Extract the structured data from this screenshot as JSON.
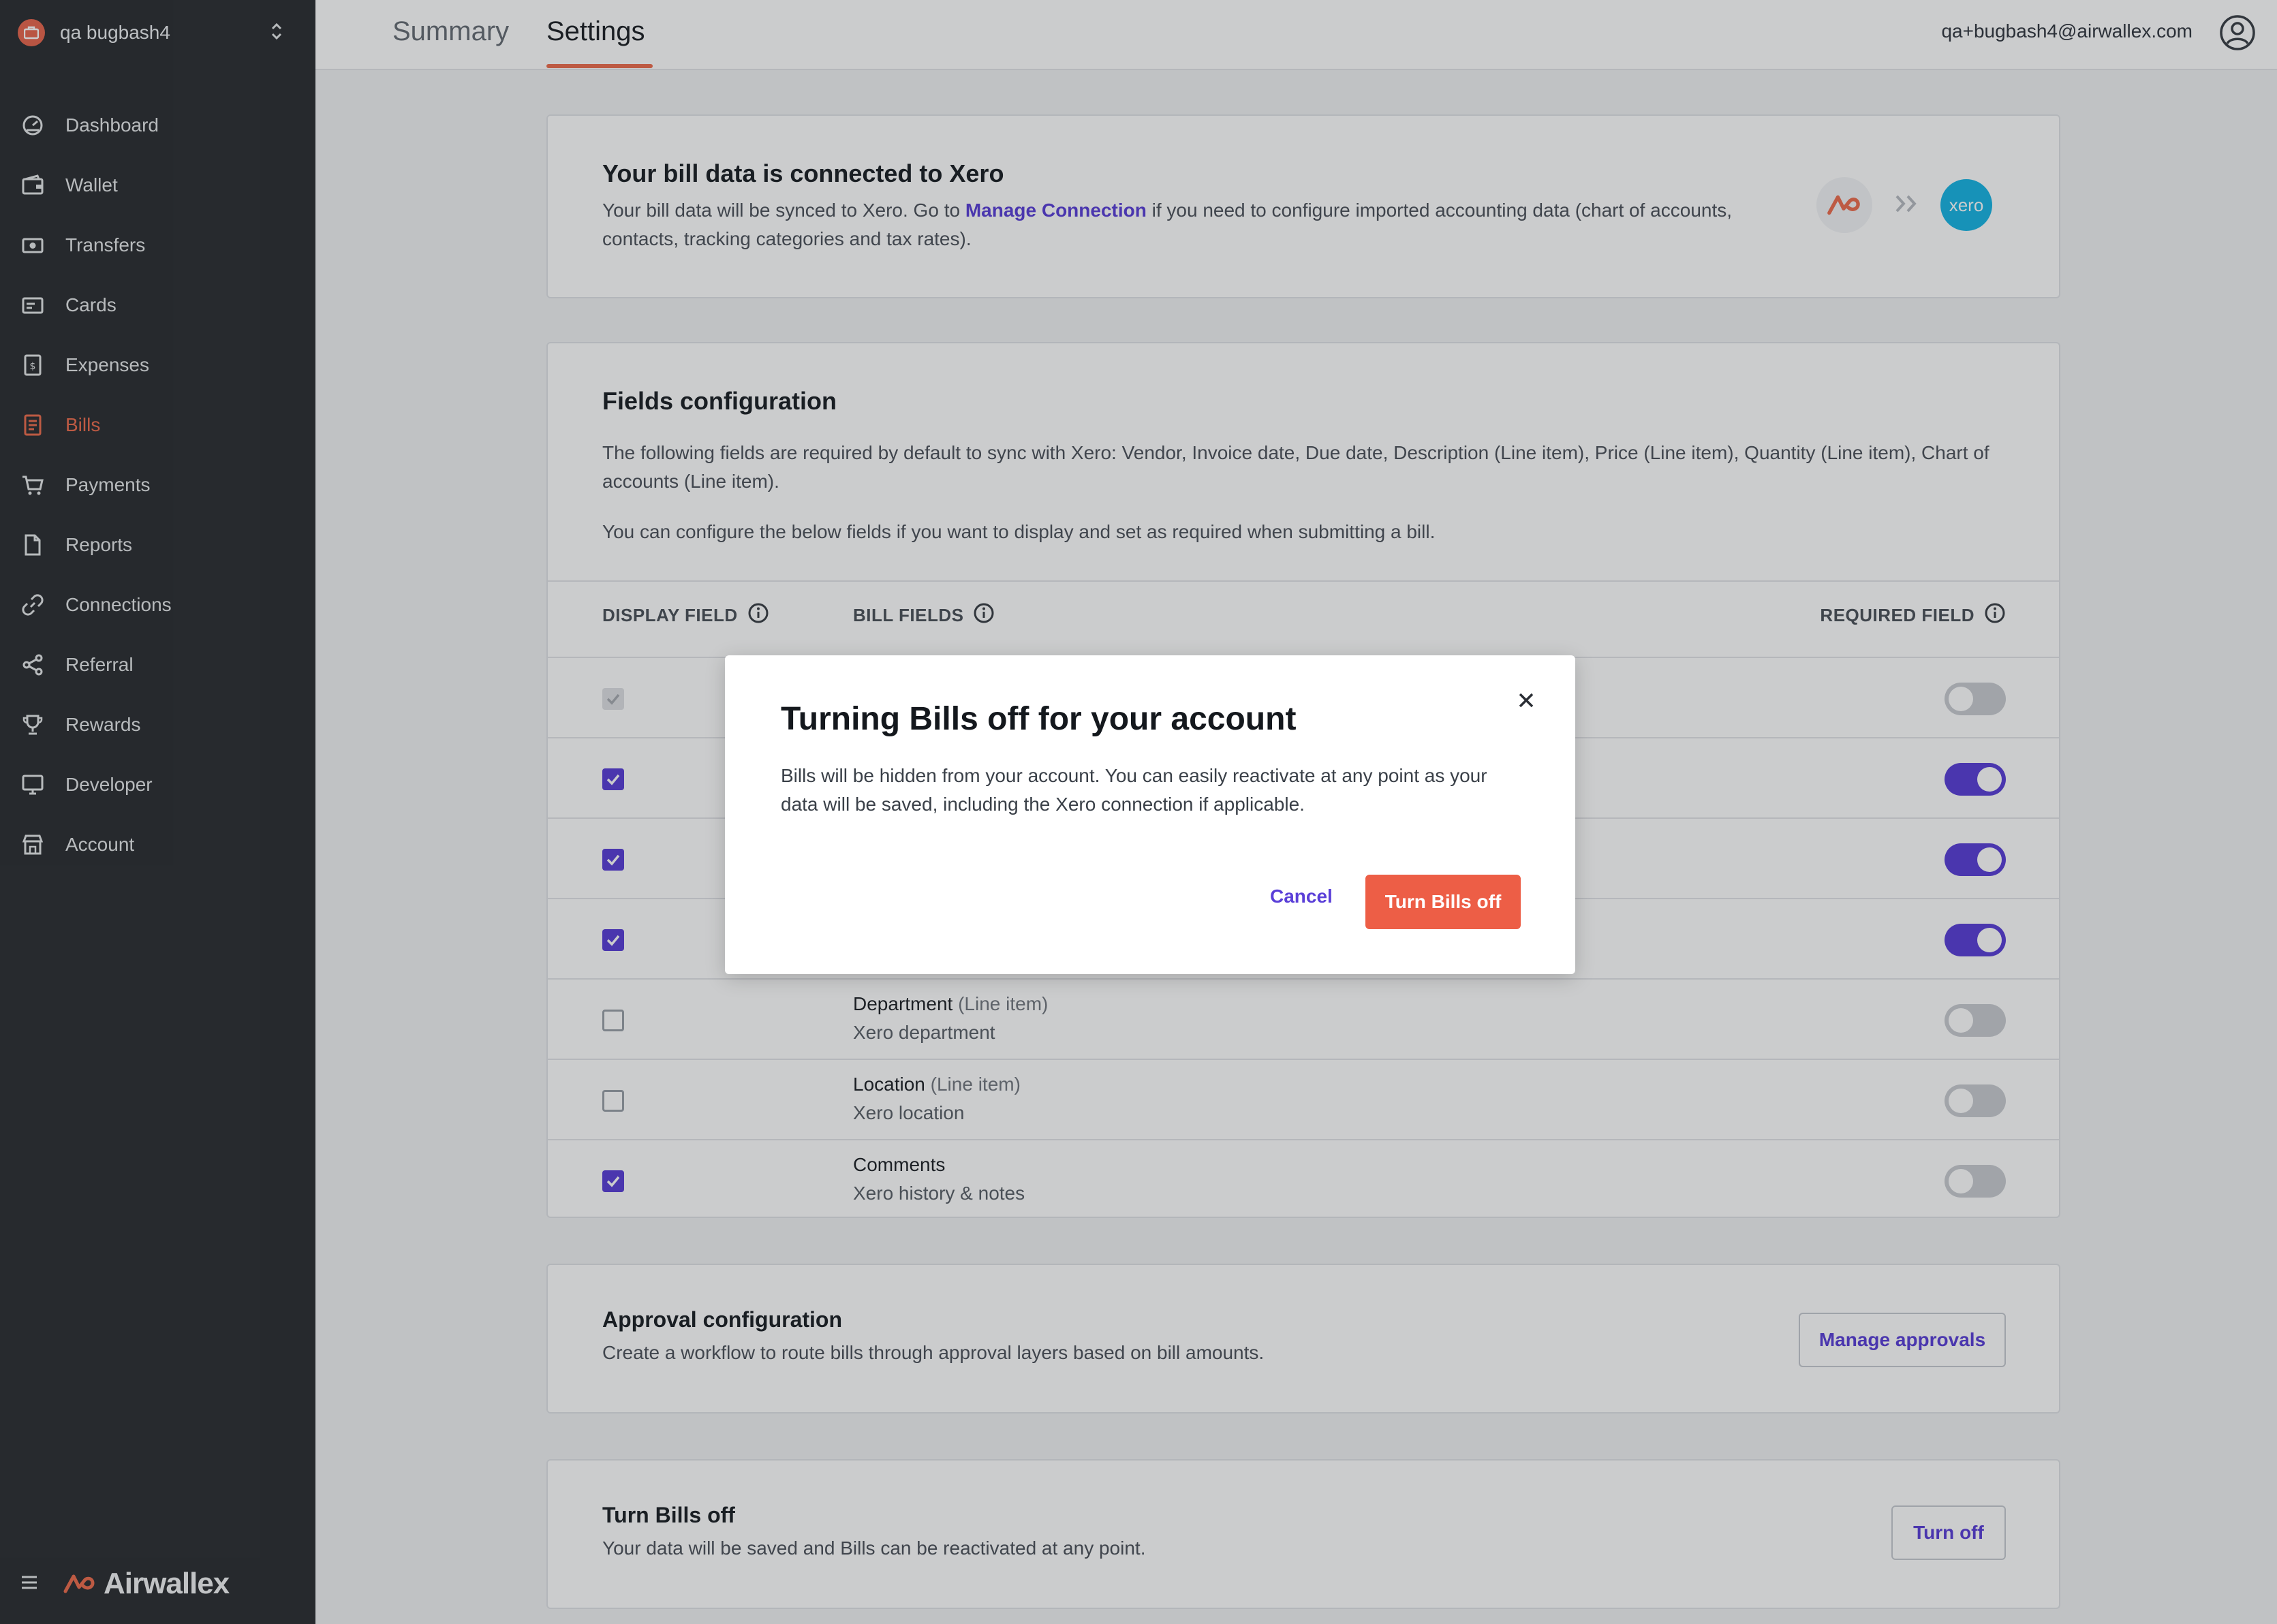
{
  "account": {
    "name": "qa bugbash4"
  },
  "nav": {
    "items": [
      {
        "label": "Dashboard",
        "icon": "dashboard-icon"
      },
      {
        "label": "Wallet",
        "icon": "wallet-icon"
      },
      {
        "label": "Transfers",
        "icon": "transfers-icon"
      },
      {
        "label": "Cards",
        "icon": "cards-icon"
      },
      {
        "label": "Expenses",
        "icon": "expenses-icon"
      },
      {
        "label": "Bills",
        "icon": "bills-icon",
        "active": true
      },
      {
        "label": "Payments",
        "icon": "cart-icon"
      },
      {
        "label": "Reports",
        "icon": "document-icon"
      },
      {
        "label": "Connections",
        "icon": "link-icon"
      },
      {
        "label": "Referral",
        "icon": "share-icon"
      },
      {
        "label": "Rewards",
        "icon": "trophy-icon"
      },
      {
        "label": "Developer",
        "icon": "monitor-icon"
      },
      {
        "label": "Account",
        "icon": "store-icon"
      }
    ],
    "brand": "Airwallex"
  },
  "header": {
    "tabs": [
      "Summary",
      "Settings"
    ],
    "active_tab": "Settings",
    "email": "qa+bugbash4@airwallex.com"
  },
  "xero_card": {
    "title": "Your bill data is connected to Xero",
    "text_before": "Your bill data will be synced to Xero. Go to ",
    "link": "Manage Connection",
    "text_after": " if you need to configure imported accounting data (chart of accounts,",
    "text_line2": "contacts, tracking categories and tax rates).",
    "xero_logo_text": "xero"
  },
  "fields_card": {
    "title": "Fields configuration",
    "desc1_line1": "The following fields are required by default to sync with Xero: Vendor, Invoice date, Due date, Description (Line item), Price (Line item), Quantity (Line item), Chart of",
    "desc1_line2": "accounts (Line item).",
    "desc2": "You can configure the below fields if you want to display and set as required when submitting a bill.",
    "col_display": "DISPLAY FIELD",
    "col_bill": "BILL FIELDS",
    "col_required": "REQUIRED FIELD",
    "rows": [
      {
        "checked": true,
        "disabled": true,
        "required": false,
        "name": "",
        "sub": "",
        "desc": ""
      },
      {
        "checked": true,
        "disabled": false,
        "required": true,
        "name": "",
        "sub": "",
        "desc": ""
      },
      {
        "checked": true,
        "disabled": false,
        "required": true,
        "name": "",
        "sub": "",
        "desc": ""
      },
      {
        "checked": true,
        "disabled": false,
        "required": true,
        "name": "",
        "sub": "",
        "desc": ""
      },
      {
        "checked": false,
        "disabled": false,
        "required": false,
        "name": "Department",
        "sub": " (Line item)",
        "desc": "Xero department"
      },
      {
        "checked": false,
        "disabled": false,
        "required": false,
        "name": "Location",
        "sub": " (Line item)",
        "desc": "Xero location"
      },
      {
        "checked": true,
        "disabled": false,
        "required": false,
        "name": "Comments",
        "sub": "",
        "desc": "Xero history & notes"
      }
    ]
  },
  "approval_card": {
    "title": "Approval configuration",
    "text": "Create a workflow to route bills through approval layers based on bill amounts.",
    "button": "Manage approvals"
  },
  "turnoff_card": {
    "title": "Turn Bills off",
    "text": "Your data will be saved and Bills can be reactivated at any point.",
    "button": "Turn off"
  },
  "modal": {
    "title": "Turning Bills off for your account",
    "body_line1": "Bills will be hidden from your account. You can easily reactivate at any point as your",
    "body_line2": "data will be saved, including the Xero connection if applicable.",
    "cancel": "Cancel",
    "confirm": "Turn Bills off"
  },
  "colors": {
    "accent": "#5a3fd8",
    "brand": "#ee6d4f",
    "danger": "#ed5e46",
    "sidebar": "#2c2f33"
  }
}
